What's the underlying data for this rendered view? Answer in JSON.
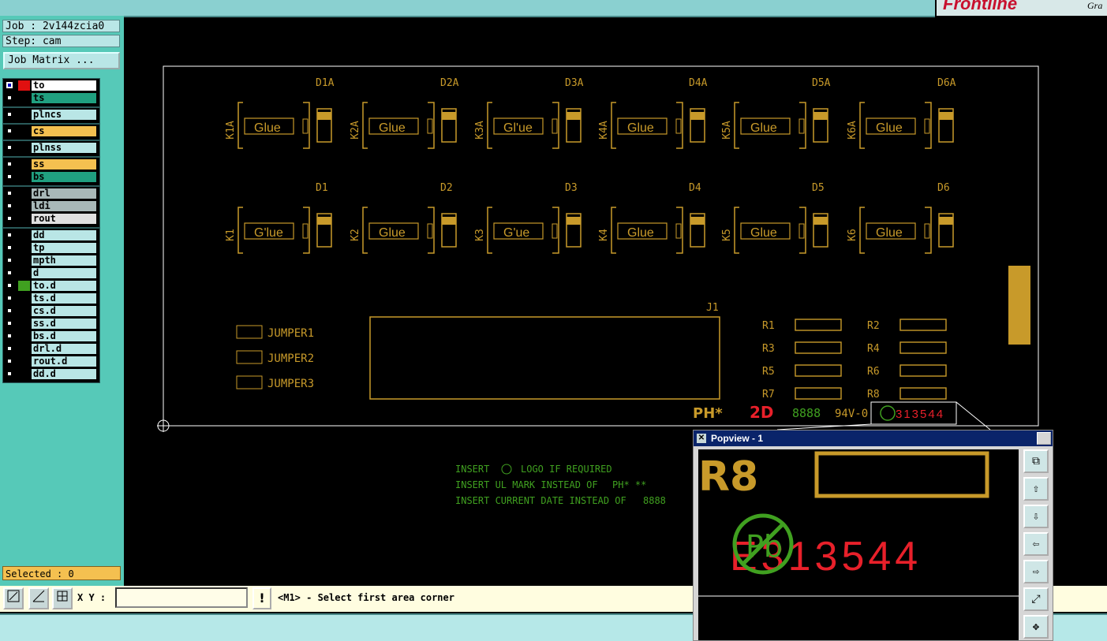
{
  "header": {
    "brand": "Frontline",
    "brand_sub": "Gra"
  },
  "left": {
    "job": "Job : 2v144zcia0",
    "step": "Step: cam",
    "job_matrix": "Job Matrix ...",
    "layers": [
      {
        "name": "to",
        "color": "#ffffff",
        "swatch": "#e01010",
        "active": true
      },
      {
        "name": "ts",
        "color": "#20a080"
      },
      {
        "name": "plncs",
        "color": "#b9e6e6"
      },
      {
        "name": "cs",
        "color": "#f4c050"
      },
      {
        "name": "plnss",
        "color": "#b9e6e6"
      },
      {
        "name": "ss",
        "color": "#f4c050"
      },
      {
        "name": "bs",
        "color": "#20a080"
      },
      {
        "name": "drl",
        "color": "#a8b8b8"
      },
      {
        "name": "ldi",
        "color": "#a8b8b8"
      },
      {
        "name": "rout",
        "color": "#e0e0e0"
      },
      {
        "name": "dd",
        "color": "#b9e6e6"
      },
      {
        "name": "tp",
        "color": "#b9e6e6"
      },
      {
        "name": "mpth",
        "color": "#b9e6e6"
      },
      {
        "name": "d",
        "color": "#b9e6e6"
      },
      {
        "name": "to.d",
        "color": "#b9e6e6",
        "swatch": "#40a020"
      },
      {
        "name": "ts.d",
        "color": "#b9e6e6"
      },
      {
        "name": "cs.d",
        "color": "#b9e6e6"
      },
      {
        "name": "ss.d",
        "color": "#b9e6e6"
      },
      {
        "name": "bs.d",
        "color": "#b9e6e6"
      },
      {
        "name": "drl.d",
        "color": "#b9e6e6"
      },
      {
        "name": "rout.d",
        "color": "#b9e6e6"
      },
      {
        "name": "dd.d",
        "color": "#b9e6e6"
      }
    ],
    "selected": "Selected : 0"
  },
  "board": {
    "top_leds": [
      "D1A",
      "D2A",
      "D3A",
      "D4A",
      "D5A",
      "D6A"
    ],
    "top_relays": [
      "K1A",
      "K2A",
      "K3A",
      "K4A",
      "K5A",
      "K6A"
    ],
    "bottom_leds": [
      "D1",
      "D2",
      "D3",
      "D4",
      "D5",
      "D6"
    ],
    "bottom_relays": [
      "K1",
      "K2",
      "K3",
      "K4",
      "K5",
      "K6"
    ],
    "glue": [
      "Glue",
      "Glue",
      "Gl'ue",
      "Glue",
      "Glue",
      "Glue",
      "G'lue",
      "Glue",
      "G'ue",
      "Glue",
      "Glue",
      "Glue"
    ],
    "jumpers": [
      "JUMPER1",
      "JUMPER2",
      "JUMPER3"
    ],
    "connector": "J1",
    "resistors": [
      "R1",
      "R2",
      "R3",
      "R4",
      "R5",
      "R6",
      "R7",
      "R8"
    ],
    "marking": {
      "ul": "PH*",
      "date_code": "2D",
      "year": "8888",
      "rating": "94V-0",
      "number": "313544"
    },
    "notes": [
      {
        "prefix": "INSERT",
        "mid": "LOGO IF REQUIRED"
      },
      {
        "prefix": "INSERT UL MARK INSTEAD OF",
        "mid": "PH*  **"
      },
      {
        "prefix": "INSERT CURRENT DATE INSTEAD OF",
        "mid": "8888"
      }
    ],
    "colors": {
      "outline": "#ffffff",
      "copper": "#c89a2a",
      "silk": "#e8202a",
      "green": "#40a020",
      "pad": "#c89a2a"
    }
  },
  "bottom": {
    "xy_label": "X Y :",
    "xy_value": "",
    "prompt": "<M1> - Select first area corner"
  },
  "popview": {
    "title": "Popview - 1",
    "label_r": "R8",
    "number": "E313544",
    "pb": "Pb"
  },
  "icons": {
    "close": "close-icon"
  }
}
